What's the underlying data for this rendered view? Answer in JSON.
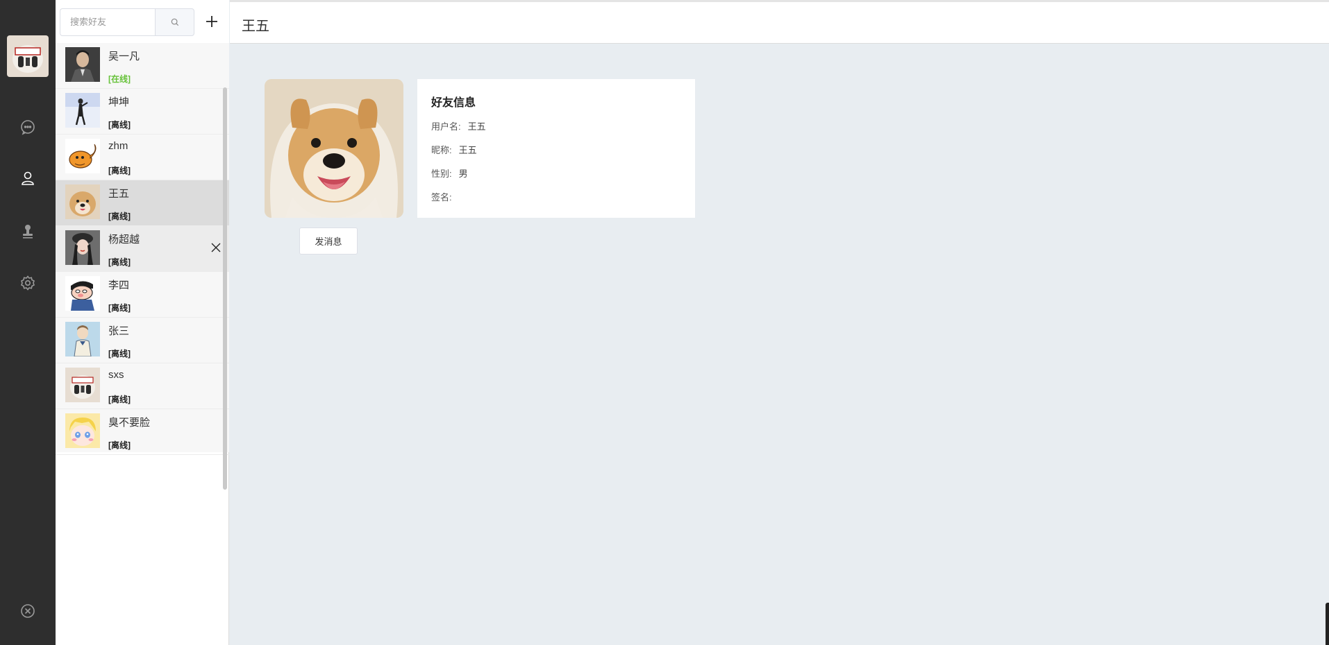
{
  "nav": {
    "icons": [
      "chat-bubble-icon",
      "contacts-user-icon",
      "stamp-icon",
      "settings-gear-icon",
      "logout-close-icon"
    ]
  },
  "search": {
    "placeholder": "搜索好友"
  },
  "friends": [
    {
      "name": "吴一凡",
      "status": "[在线]",
      "online": true
    },
    {
      "name": "坤坤",
      "status": "[离线]",
      "online": false
    },
    {
      "name": "zhm",
      "status": "[离线]",
      "online": false
    },
    {
      "name": "王五",
      "status": "[离线]",
      "online": false,
      "selected": true
    },
    {
      "name": "杨超越",
      "status": "[离线]",
      "online": false
    },
    {
      "name": "李四",
      "status": "[离线]",
      "online": false
    },
    {
      "name": "张三",
      "status": "[离线]",
      "online": false
    },
    {
      "name": "sxs",
      "status": "[离线]",
      "online": false
    },
    {
      "name": "臭不要脸",
      "status": "[离线]",
      "online": false
    }
  ],
  "main": {
    "title": "王五",
    "send_label": "发消息",
    "info": {
      "heading": "好友信息",
      "username_label": "用户名:",
      "username": "王五",
      "nickname_label": "昵称:",
      "nickname": "王五",
      "gender_label": "性别:",
      "gender": "男",
      "signature_label": "签名:",
      "signature": ""
    }
  },
  "colors": {
    "nav_bg": "#2e2e2e",
    "online": "#67c23a",
    "selected_row": "#dcdcdc",
    "main_bg": "#e8edf1"
  }
}
